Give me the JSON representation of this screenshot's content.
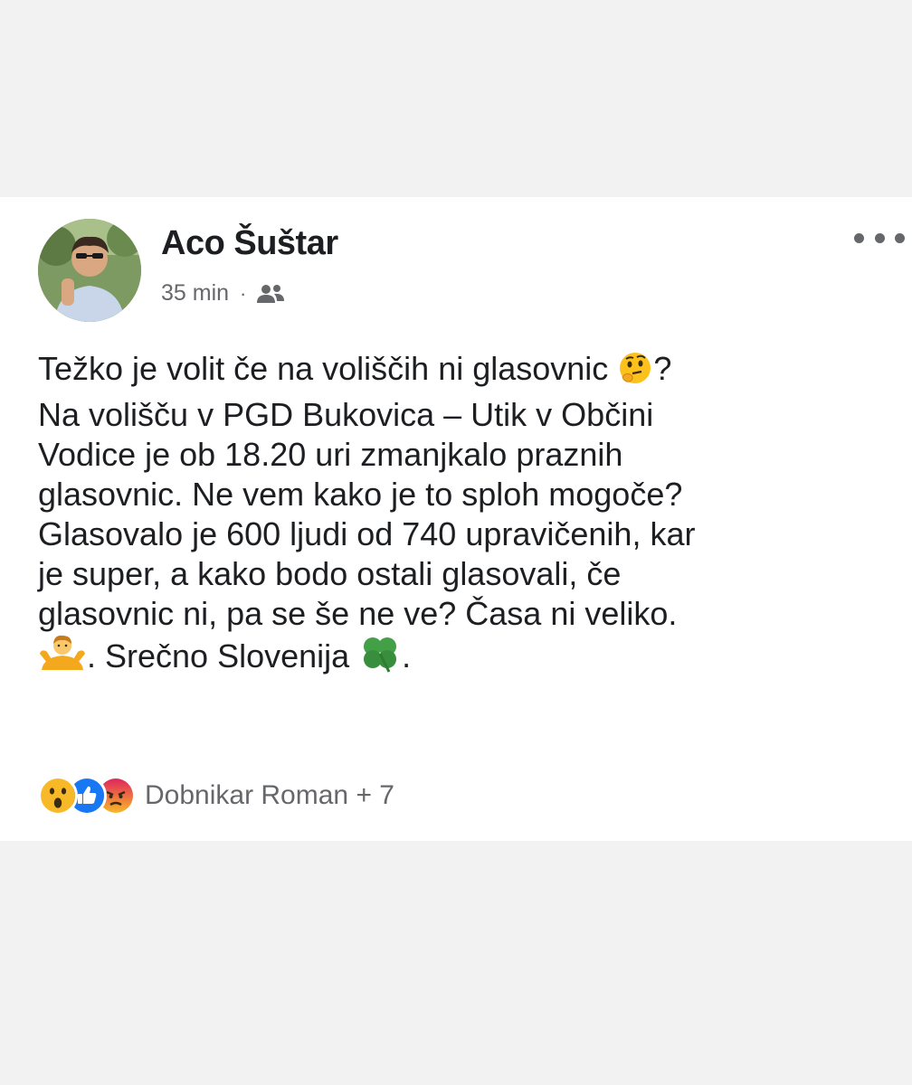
{
  "post": {
    "author": "Aco Šuštar",
    "time": "35 min",
    "separator": "·",
    "audience_icon": "friends-icon",
    "lines": {
      "l1": "Težko je volit če na voliščih ni glasovnic ",
      "l1_end": "?",
      "l2": "Na volišču v PGD Bukovica – Utik v Občini",
      "l3": "Vodice je ob 18.20 uri zmanjkalo praznih",
      "l4": "glasovnic. Ne vem kako je to sploh mogoče?",
      "l5": "Glasovalo je 600 ljudi od 740 upravičenih, kar",
      "l6": "je super, a kako bodo ostali glasovali, če",
      "l7": "glasovnic ni, pa se še ne ve?  Časa ni veliko.",
      "l8_mid": ". Srečno Slovenija ",
      "l8_end": "."
    },
    "emojis": [
      "thinking-face-emoji",
      "person-shrugging-emoji",
      "four-leaf-clover-emoji"
    ]
  },
  "reactions": {
    "icons": [
      "wow-icon",
      "like-icon",
      "angry-icon"
    ],
    "label": "Dobnikar Roman + 7"
  },
  "colors": {
    "text": "#1c1e21",
    "secondary": "#65676b",
    "like": "#1877f2",
    "wow": "#f7b928",
    "angry": "#e9710f"
  }
}
